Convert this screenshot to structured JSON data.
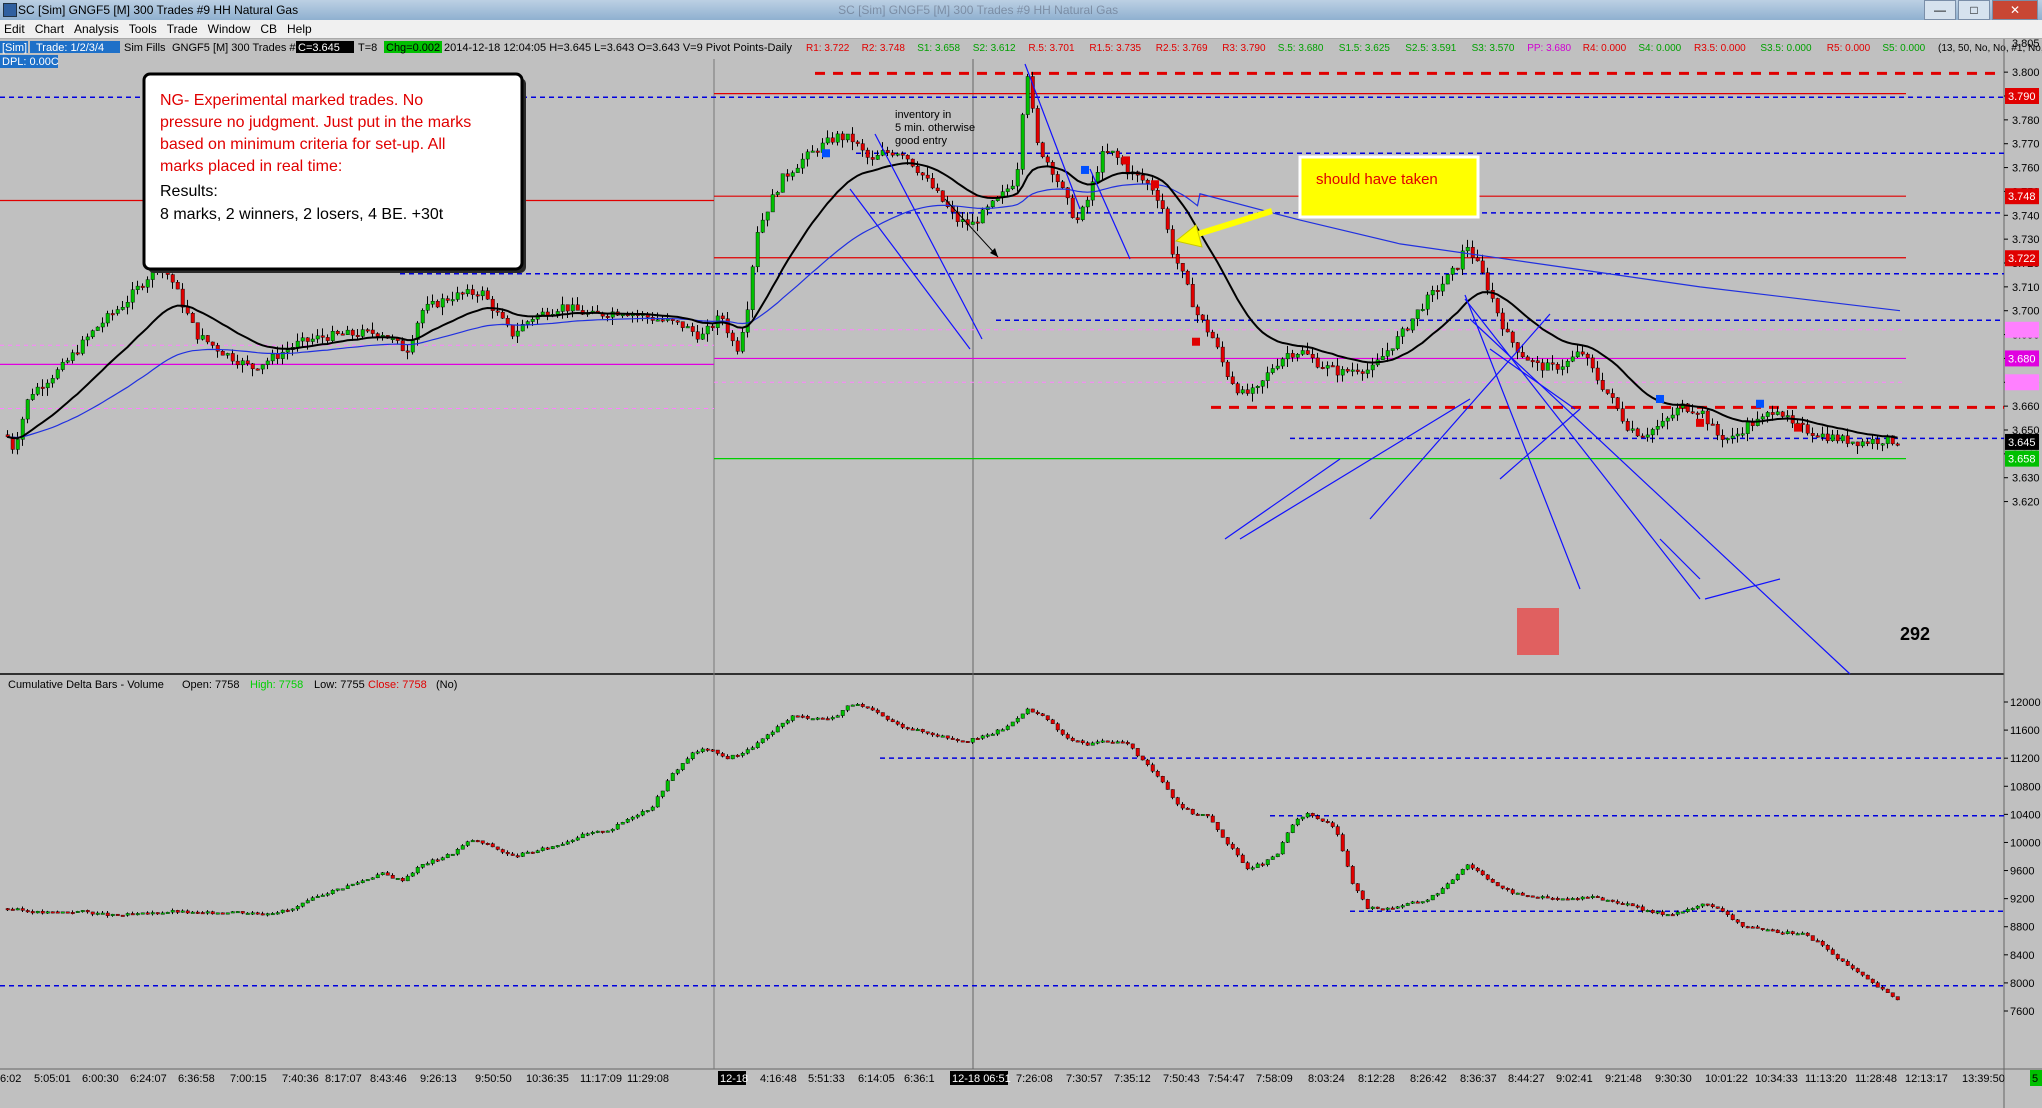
{
  "window": {
    "title": "SC [Sim] GNGF5 [M] 300 Trades #9 HH Natural Gas",
    "faint_title": "SC [Sim] GNGF5 [M] 300 Trades #9 HH Natural Gas",
    "icon": "sierra-chart-icon",
    "buttons": [
      "minimize-icon",
      "maximize-icon",
      "close-icon"
    ]
  },
  "menu": [
    "Edit",
    "Chart",
    "Analysis",
    "Tools",
    "Trade",
    "Window",
    "CB",
    "Help"
  ],
  "header": {
    "account_tag": "[Sim]",
    "trade_label": "Trade: 1/2/3/4",
    "sim_fills": "Sim Fills",
    "symbol_info": "GNGF5 [M]  300 Trades  #9",
    "price_tag": "C=3.645",
    "trades_count": "T=8",
    "change_tag": "Chg=0.002",
    "bar_info": "2014-12-18 12:04:05 H=3.645 L=3.643 O=3.643 V=9 Pivot Points-Daily",
    "dpl": "DPL: 0.00C",
    "pivots": [
      {
        "text": "R1: 3.722",
        "color": "#e00000"
      },
      {
        "text": "R2: 3.748",
        "color": "#e00000"
      },
      {
        "text": "S1: 3.658",
        "color": "#00a000"
      },
      {
        "text": "S2: 3.612",
        "color": "#00a000"
      },
      {
        "text": "R.5: 3.701",
        "color": "#e00000"
      },
      {
        "text": "R1.5: 3.735",
        "color": "#e00000"
      },
      {
        "text": "R2.5: 3.769",
        "color": "#e00000"
      },
      {
        "text": "R3: 3.790",
        "color": "#e00000"
      },
      {
        "text": "S.5: 3.680",
        "color": "#00a000"
      },
      {
        "text": "S1.5: 3.625",
        "color": "#00a000"
      },
      {
        "text": "S2.5: 3.591",
        "color": "#00a000"
      },
      {
        "text": "S3: 3.570",
        "color": "#00a000"
      },
      {
        "text": "PP: 3.680",
        "color": "#d000d0"
      },
      {
        "text": "R4: 0.000",
        "color": "#e00000"
      },
      {
        "text": "S4: 0.000",
        "color": "#00a000"
      },
      {
        "text": "R3.5: 0.000",
        "color": "#e00000"
      },
      {
        "text": "S3.5: 0.000",
        "color": "#00a000"
      },
      {
        "text": "R5: 0.000",
        "color": "#e00000"
      },
      {
        "text": "S5: 0.000",
        "color": "#00a000"
      },
      {
        "text": "(13, 50, No, No, #1, No, No, I",
        "color": "#000000"
      }
    ]
  },
  "note_box": {
    "lines": [
      "NG- Experimental marked trades.  No",
      "pressure no judgment.  Just put in the marks",
      "based on minimum criteria for set-up.  All",
      "marks placed in real time:"
    ],
    "results_label": "Results:",
    "results": "8 marks, 2 winners, 2 losers, 4 BE. +30t"
  },
  "callout": {
    "text": "should have taken"
  },
  "annotation": {
    "lines": [
      "inventory in",
      "5 min. otherwise",
      "good entry"
    ]
  },
  "bar_count": "292",
  "price_axis": {
    "ticks": [
      "3.800",
      "3.790",
      "3.780",
      "3.770",
      "3.760",
      "3.750",
      "3.740",
      "3.730",
      "3.720",
      "3.710",
      "3.700",
      "3.690",
      "3.680",
      "3.670",
      "3.660",
      "3.650",
      "3.640",
      "3.630",
      "3.620"
    ],
    "top_label": "3.805",
    "tags": [
      {
        "text": "3.790",
        "bg": "#e00000",
        "color": "#ffffff",
        "price": 3.79
      },
      {
        "text": "3.748",
        "bg": "#e00000",
        "color": "#ffffff",
        "price": 3.748
      },
      {
        "text": "3.722",
        "bg": "#e00000",
        "color": "#ffffff",
        "price": 3.722
      },
      {
        "text": "3.680",
        "bg": "#e000e0",
        "color": "#ffffff",
        "price": 3.68
      },
      {
        "text": "3.645",
        "bg": "#000000",
        "color": "#ffffff",
        "price": 3.645
      },
      {
        "text": "3.658",
        "bg": "#00c000",
        "color": "#ffffff",
        "price": 3.638
      }
    ]
  },
  "delta_panel": {
    "legend": {
      "name": "Cumulative Delta Bars - Volume",
      "open": "Open: 7758",
      "high": "High: 7758",
      "low": "Low: 7755",
      "close": "Close: 7758",
      "flag": "(No)"
    },
    "ticks": [
      "12000",
      "11600",
      "11200",
      "10800",
      "10400",
      "10000",
      "9600",
      "9200",
      "8800",
      "8400",
      "8000",
      "7600"
    ]
  },
  "time_axis": {
    "labels": [
      "6:02",
      "5:05:01",
      "6:00:30",
      "6:24:07",
      "6:36:58",
      "7:00:15",
      "7:40:36",
      "8:17:07",
      "8:43:46",
      "9:26:13",
      "9:50:50",
      "10:36:35",
      "11:17:09",
      "11:29:08",
      "12-18",
      "4:16:48",
      "5:51:33",
      "6:14:05",
      "6:36:1",
      "12-18  06:51",
      "7:26:08",
      "7:30:57",
      "7:35:12",
      "7:50:43",
      "7:54:47",
      "7:58:09",
      "8:03:24",
      "8:12:28",
      "8:26:42",
      "8:36:37",
      "8:44:27",
      "9:02:41",
      "9:21:48",
      "9:30:30",
      "10:01:22",
      "10:34:33",
      "11:13:20",
      "11:28:48",
      "12:13:17",
      "13:39:50"
    ],
    "right_tag": "5"
  },
  "colors": {
    "chart_bg": "#c0c0c0",
    "up_candle": "#00c000",
    "down_candle": "#e00000",
    "ema": "#000000",
    "vwap": "#2030e0",
    "pivot_red": "#e00000",
    "pivot_magenta": "#e000e0",
    "pivot_green": "#00d000",
    "level_blue": "#0000e0",
    "callout_bg": "#ffff00"
  }
}
